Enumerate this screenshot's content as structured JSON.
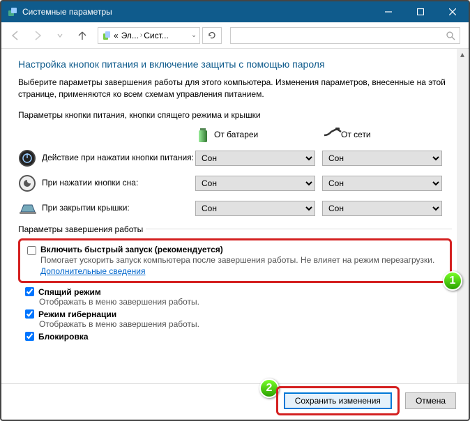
{
  "window": {
    "title": "Системные параметры"
  },
  "breadcrumb": {
    "part1": "Эл...",
    "part2": "Сист..."
  },
  "page": {
    "title": "Настройка кнопок питания и включение защиты с помощью пароля",
    "description": "Выберите параметры завершения работы для этого компьютера. Изменения параметров, внесенные на этой странице, применяются ко всем схемам управления питанием."
  },
  "buttonSection": {
    "title": "Параметры кнопки питания, кнопки спящего режима и крышки",
    "col_battery": "От батареи",
    "col_ac": "От сети",
    "rows": [
      {
        "label": "Действие при нажатии кнопки питания:",
        "battery": "Сон",
        "ac": "Сон"
      },
      {
        "label": "При нажатии кнопки сна:",
        "battery": "Сон",
        "ac": "Сон"
      },
      {
        "label": "При закрытии крышки:",
        "battery": "Сон",
        "ac": "Сон"
      }
    ]
  },
  "shutdown": {
    "title": "Параметры завершения работы",
    "fastboot": {
      "label": "Включить быстрый запуск (рекомендуется)",
      "desc": "Помогает ускорить запуск компьютера после завершения работы. Не влияет на режим перезагрузки. ",
      "link": "Дополнительные сведения"
    },
    "sleep": {
      "label": "Спящий режим",
      "desc": "Отображать в меню завершения работы."
    },
    "hibernate": {
      "label": "Режим гибернации",
      "desc": "Отображать в меню завершения работы."
    },
    "lock": {
      "label": "Блокировка"
    }
  },
  "buttons": {
    "save": "Сохранить изменения",
    "cancel": "Отмена"
  },
  "badges": {
    "one": "1",
    "two": "2"
  }
}
